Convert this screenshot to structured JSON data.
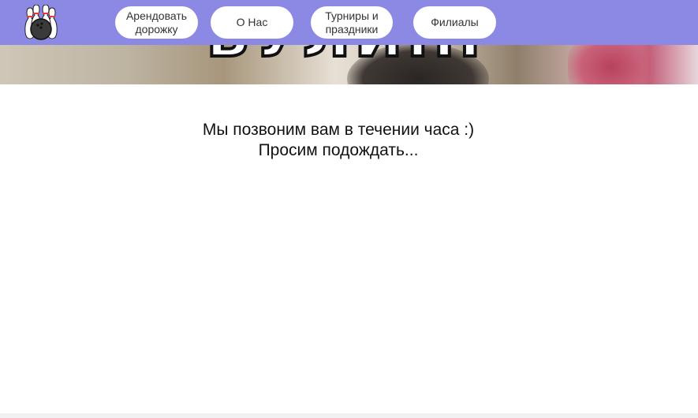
{
  "hero": {
    "title": "БУЛИНГ"
  },
  "nav": {
    "logo_icon": "bowling-pins-icon",
    "items": [
      {
        "line1": "Арендовать",
        "line2": "дорожку"
      },
      {
        "line1": "О Нас",
        "line2": ""
      },
      {
        "line1": "Турниры и",
        "line2": "праздники"
      },
      {
        "line1": "Филиалы",
        "line2": ""
      }
    ]
  },
  "message": {
    "line1": "Мы позвоним вам в течении часа :)",
    "line2": "Просим подождать..."
  },
  "colors": {
    "nav_background": "#8b89e3",
    "button_background": "#ffffff",
    "text": "#111111"
  }
}
